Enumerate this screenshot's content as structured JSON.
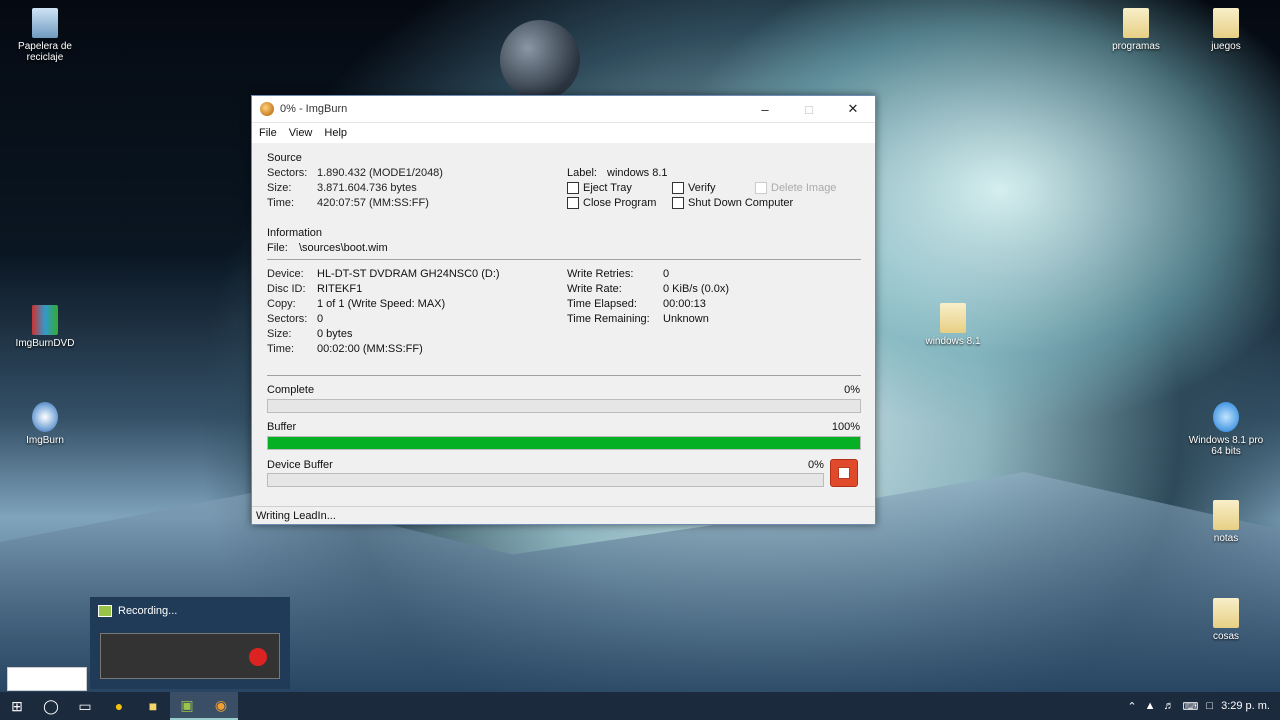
{
  "desktop": {
    "icons_left": [
      {
        "label": "Papelera de reciclaje"
      },
      {
        "label": "ImgBurnDVD"
      },
      {
        "label": "ImgBurn"
      }
    ],
    "icons_right": [
      {
        "label": "programas"
      },
      {
        "label": "juegos"
      },
      {
        "label": "windows 8.1"
      },
      {
        "label": "Windows 8.1 pro 64 bits"
      },
      {
        "label": "notas"
      },
      {
        "label": "cosas"
      }
    ]
  },
  "window": {
    "title": "0% - ImgBurn",
    "menu": [
      "File",
      "View",
      "Help"
    ],
    "source": {
      "heading": "Source",
      "sectors_label": "Sectors:",
      "sectors": "1.890.432 (MODE1/2048)",
      "size_label": "Size:",
      "size": "3.871.604.736 bytes",
      "time_label": "Time:",
      "time": "420:07:57 (MM:SS:FF)",
      "label_label": "Label:",
      "label": "windows 8.1",
      "eject_tray": "Eject Tray",
      "verify": "Verify",
      "delete_image": "Delete Image",
      "close_program": "Close Program",
      "shutdown": "Shut Down Computer"
    },
    "information": {
      "heading": "Information",
      "file_label": "File:",
      "file": "\\sources\\boot.wim",
      "device_label": "Device:",
      "device": "HL-DT-ST DVDRAM GH24NSC0 (D:)",
      "discid_label": "Disc ID:",
      "discid": "RITEKF1",
      "copy_label": "Copy:",
      "copy": "1 of 1 (Write Speed: MAX)",
      "sectors_label": "Sectors:",
      "sectors": "0",
      "size_label": "Size:",
      "size": "0 bytes",
      "time_label": "Time:",
      "time": "00:02:00 (MM:SS:FF)",
      "retries_label": "Write Retries:",
      "retries": "0",
      "rate_label": "Write Rate:",
      "rate": "0 KiB/s (0.0x)",
      "elapsed_label": "Time Elapsed:",
      "elapsed": "00:00:13",
      "remaining_label": "Time Remaining:",
      "remaining": "Unknown"
    },
    "progress": {
      "complete_label": "Complete",
      "complete_pct": "0%",
      "complete_value": 0,
      "buffer_label": "Buffer",
      "buffer_pct": "100%",
      "buffer_value": 100,
      "device_buffer_label": "Device Buffer",
      "device_buffer_pct": "0%",
      "device_buffer_value": 0
    },
    "status": "Writing LeadIn..."
  },
  "recording": {
    "text": "Recording..."
  },
  "taskbar": {
    "clock": "3:29 p. m."
  }
}
